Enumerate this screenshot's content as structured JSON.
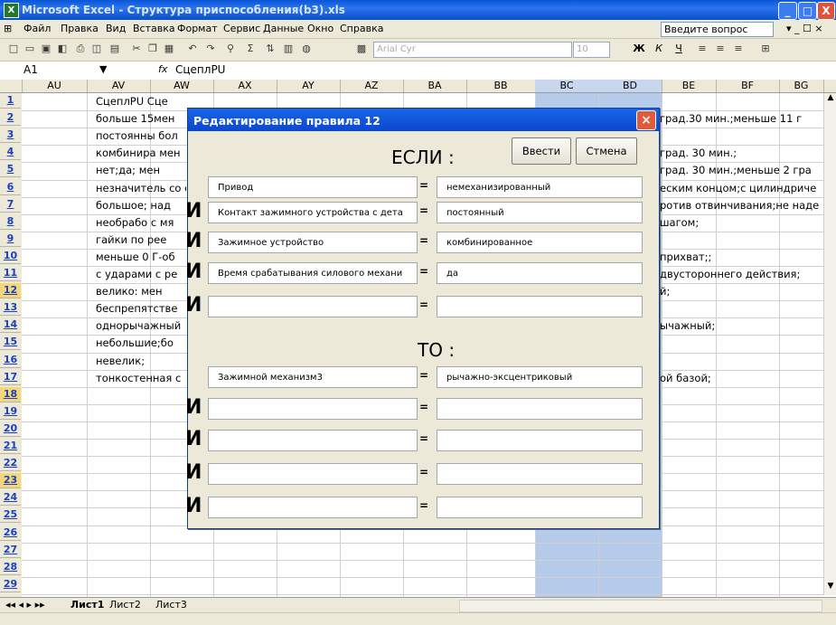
{
  "window": {
    "title": "Microsoft Excel - Структура приспособления(b3).xls",
    "app_icon": "excel-icon",
    "controls": [
      "_",
      "□",
      "X"
    ]
  },
  "menu": {
    "items": [
      "Файл",
      "Правка",
      "Вид",
      "Вставка",
      "Формат",
      "Сервис",
      "Данные",
      "Окно",
      "Справка"
    ],
    "help_placeholder": "Введите вопрос"
  },
  "toolbar": {
    "font_name": "Arial Cyr",
    "font_size": "10",
    "bold": "Ж",
    "italic": "К",
    "underline": "Ч"
  },
  "formula_bar": {
    "cell_ref": "A1",
    "fx": "fx",
    "value": "СцеплPU"
  },
  "grid": {
    "columns": [
      "AU",
      "AV",
      "AW",
      "AX",
      "AY",
      "AZ",
      "BA",
      "BB",
      "BC",
      "BD",
      "BE",
      "BF",
      "BG"
    ],
    "rows": [
      "1",
      "2",
      "3",
      "4",
      "5",
      "6",
      "7",
      "8",
      "9",
      "10",
      "11",
      "12",
      "13",
      "14",
      "15",
      "16",
      "17",
      "18",
      "19",
      "20",
      "21",
      "22",
      "23",
      "24",
      "25",
      "26",
      "27",
      "28",
      "29"
    ],
    "left_texts": [
      "СцеплPU  Сце",
      "больше 15мен",
      "постоянны бол",
      "комбинира мен",
      "нет;да;    мен",
      "незначитель со с",
      "большое;  над",
      "необрабо с мя",
      "гайки по  рее",
      "меньше 0 Г-об",
      "с ударами с ре",
      "велико:   мен",
      "беспрепятстве",
      "однорычажный",
      "небольшие;бо",
      "невелик;",
      "тонкостенная с"
    ],
    "right_texts": [
      "",
      "град.30 мин.;меньше 11 г",
      "",
      "град. 30 мин.;",
      "град. 30 мин.;меньше 2 гра",
      "еским концом;с цилиндриче",
      "ротив отвинчивания;не наде",
      "шагом;",
      "",
      "прихват;;",
      "двустороннего действия;",
      "й;",
      "",
      "ычажный;",
      "",
      "",
      "ой базой;"
    ]
  },
  "dialog": {
    "title": "Редактирование правила 12",
    "close": "×",
    "if_label": "ЕСЛИ :",
    "then_label": "ТО :",
    "ok_button": "Ввести",
    "cancel_button": "Стмена",
    "and_label": "И",
    "eq": "=",
    "conditions": [
      {
        "attr": "Привод",
        "value": "немеханизированный"
      },
      {
        "attr": "Контакт зажимного устройства с дета",
        "value": "постоянный"
      },
      {
        "attr": "Зажимное устройство",
        "value": "комбинированное"
      },
      {
        "attr": "Время срабатывания силового механи",
        "value": "да"
      },
      {
        "attr": "",
        "value": ""
      }
    ],
    "conclusions": [
      {
        "attr": "Зажимной механизм3",
        "value": "рычажно-эксцентриковый"
      },
      {
        "attr": "",
        "value": ""
      },
      {
        "attr": "",
        "value": ""
      },
      {
        "attr": "",
        "value": ""
      },
      {
        "attr": "",
        "value": ""
      }
    ]
  },
  "sheets": {
    "tabs": [
      "Лист1",
      "Лист2",
      "Лист3"
    ],
    "active": "Лист1"
  },
  "colors": {
    "title_bar": "#0a56d8",
    "dialog_title": "#1a64e8",
    "selected_column": "#b6cbea",
    "row_header_highlight": "#f5d778"
  }
}
